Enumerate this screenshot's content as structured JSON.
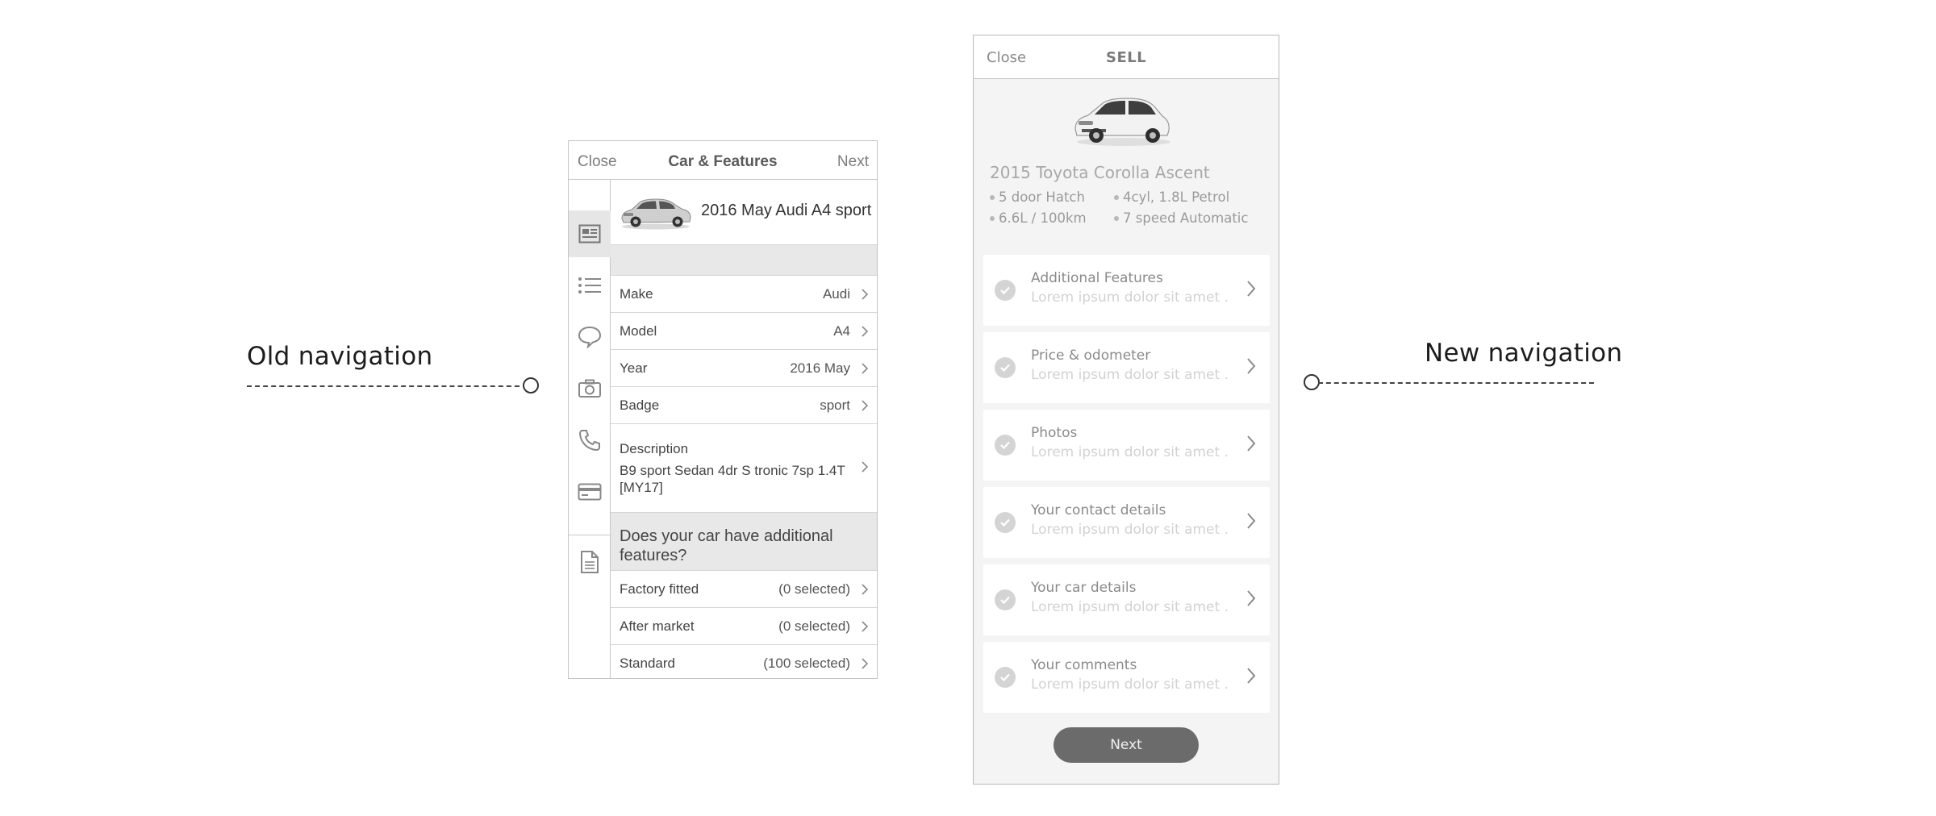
{
  "annotations": {
    "old_label": "Old navigation",
    "new_label": "New navigation"
  },
  "old_screen": {
    "topbar": {
      "close": "Close",
      "title": "Car & Features",
      "next": "Next"
    },
    "rail_icons": [
      "listing-icon",
      "list-icon",
      "speech-bubble-icon",
      "camera-icon",
      "phone-icon",
      "credit-card-icon",
      "document-icon"
    ],
    "car_title": "2016 May Audi A4 sport",
    "rows": [
      {
        "label": "Make",
        "value": "Audi"
      },
      {
        "label": "Model",
        "value": "A4"
      },
      {
        "label": "Year",
        "value": "2016 May"
      },
      {
        "label": "Badge",
        "value": "sport"
      }
    ],
    "description": {
      "label": "Description",
      "text": "B9 sport Sedan 4dr S tronic 7sp 1.4T [MY17]"
    },
    "question": "Does your car have additional features?",
    "feature_rows": [
      {
        "label": "Factory fitted",
        "value": "(0 selected)"
      },
      {
        "label": "After market",
        "value": "(0 selected)"
      },
      {
        "label": "Standard",
        "value": "(100 selected)"
      }
    ]
  },
  "new_screen": {
    "topbar": {
      "close": "Close",
      "title": "SELL"
    },
    "car_title": "2015 Toyota Corolla Ascent",
    "specs": [
      "5 door Hatch",
      "4cyl, 1.8L Petrol",
      "6.6L / 100km",
      "7 speed Automatic"
    ],
    "sections": [
      {
        "title": "Additional Features",
        "subtitle": "Lorem ipsum dolor sit amet ."
      },
      {
        "title": "Price & odometer",
        "subtitle": "Lorem ipsum dolor sit amet ."
      },
      {
        "title": "Photos",
        "subtitle": "Lorem ipsum dolor sit amet ."
      },
      {
        "title": "Your contact details",
        "subtitle": "Lorem ipsum dolor sit amet ."
      },
      {
        "title": "Your car details",
        "subtitle": "Lorem ipsum dolor sit amet ."
      },
      {
        "title": "Your comments",
        "subtitle": "Lorem ipsum dolor sit amet ."
      }
    ],
    "next_button": "Next"
  },
  "colors": {
    "band_grey": "#e8e8e8",
    "panel_bg": "#f4f4f4",
    "next_button": "#6b6b6b"
  }
}
